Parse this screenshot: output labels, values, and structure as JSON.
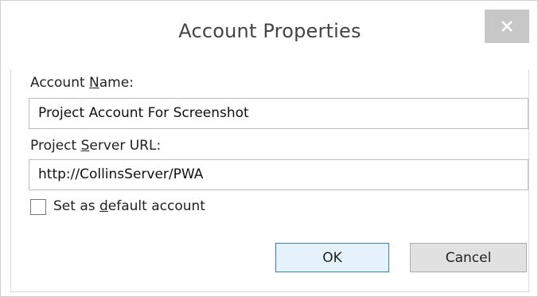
{
  "dialog": {
    "title": "Account Properties",
    "close_icon": "close-icon"
  },
  "account_name": {
    "label_pre": "Account ",
    "label_accel": "N",
    "label_post": "ame:",
    "value": "Project Account For Screenshot"
  },
  "server_url": {
    "label_pre": "Project ",
    "label_accel": "S",
    "label_post": "erver URL:",
    "value": "http://CollinsServer/PWA"
  },
  "default_account": {
    "label_pre": "Set as ",
    "label_accel": "d",
    "label_post": "efault account",
    "checked": false
  },
  "buttons": {
    "ok_label": "OK",
    "cancel_label": "Cancel"
  },
  "colors": {
    "close_button_bg": "#c7c7c7",
    "ok_button_border": "#3c7fb1",
    "ok_button_bg": "#e5f1fb"
  }
}
